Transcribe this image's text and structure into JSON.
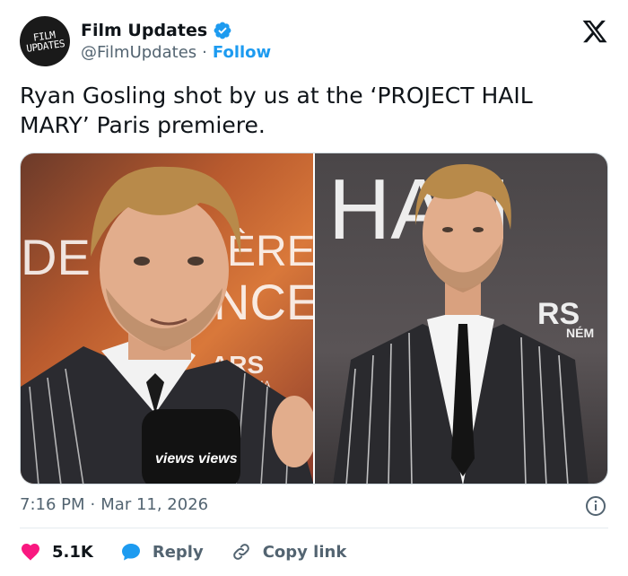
{
  "header": {
    "avatar_line1": "FILM",
    "avatar_line2": "UPDATES",
    "display_name": "Film Updates",
    "handle": "@FilmUpdates",
    "separator": "·",
    "follow_label": "Follow"
  },
  "tweet": {
    "text": "Ryan Gosling shot by us at the ‘PROJECT HAIL MARY’ Paris premiere."
  },
  "media": {
    "left_photo": {
      "bg_text_1": "DE",
      "bg_text_2": "ÈRE",
      "bg_text_3": "NCE",
      "bg_text_4": "ARS",
      "bg_text_5": "CINÉMA",
      "mic_text": "views views"
    },
    "right_photo": {
      "bg_text_1": "HAN",
      "bg_text_2": "RS",
      "bg_text_3": "NÉM"
    }
  },
  "meta": {
    "time": "7:16 PM",
    "separator": "·",
    "date": "Mar 11, 2026"
  },
  "actions": {
    "like_count": "5.1K",
    "reply_label": "Reply",
    "copy_label": "Copy link"
  },
  "colors": {
    "accent": "#1d9bf0",
    "like": "#f91880",
    "text": "#0f1419",
    "muted": "#536471"
  }
}
